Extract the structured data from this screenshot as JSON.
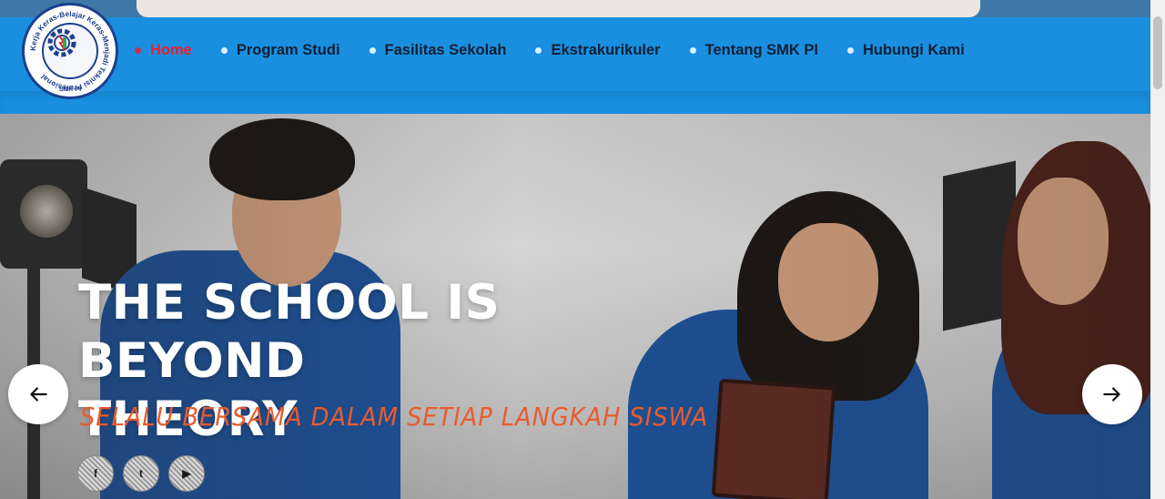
{
  "nav": {
    "items": [
      {
        "label": "Home",
        "active": true
      },
      {
        "label": "Program Studi",
        "active": false
      },
      {
        "label": "Fasilitas Sekolah",
        "active": false
      },
      {
        "label": "Ekstrakurikuler",
        "active": false
      },
      {
        "label": "Tentang SMK PI",
        "active": false
      },
      {
        "label": "Hubungi Kami",
        "active": false
      }
    ],
    "active_color": "#e8202f",
    "bar_color": "#1a8fe0"
  },
  "logo": {
    "ring_text": "Kerja Keras-Belajar Keras-Menjadi Teknisi Profesional",
    "bottom_text": "SMK-PI"
  },
  "hero": {
    "headline_line1": "THE SCHOOL IS BEYOND",
    "headline_line2": "THEORY",
    "tagline": "SELALU BERSAMA DALAM SETIAP LANGKAH SISWA",
    "tagline_color": "#ea5b2c"
  },
  "socials": [
    {
      "icon": "facebook-icon",
      "glyph": "f"
    },
    {
      "icon": "twitter-icon",
      "glyph": "t"
    },
    {
      "icon": "youtube-icon",
      "glyph": "▶"
    }
  ],
  "carousel": {
    "prev_icon": "arrow-left-icon",
    "next_icon": "arrow-right-icon"
  }
}
